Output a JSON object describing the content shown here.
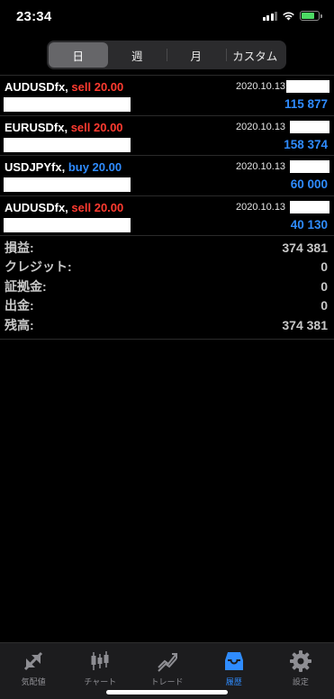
{
  "status_bar": {
    "time": "23:34"
  },
  "period_tabs": [
    {
      "label": "日",
      "active": true
    },
    {
      "label": "週",
      "active": false
    },
    {
      "label": "月",
      "active": false
    },
    {
      "label": "カスタム",
      "active": false
    }
  ],
  "deals": [
    {
      "symbol": "AUDUSDfx,",
      "side": "sell 20.00",
      "side_type": "sell",
      "date": "2020.10.13",
      "profit": "115 877"
    },
    {
      "symbol": "EURUSDfx,",
      "side": "sell 20.00",
      "side_type": "sell",
      "date": "2020.10.13",
      "profit": "158 374"
    },
    {
      "symbol": "USDJPYfx,",
      "side": "buy 20.00",
      "side_type": "buy",
      "date": "2020.10.13",
      "profit": "60 000"
    },
    {
      "symbol": "AUDUSDfx,",
      "side": "sell 20.00",
      "side_type": "sell",
      "date": "2020.10.13",
      "profit": "40 130"
    }
  ],
  "summary": [
    {
      "label": "損益:",
      "value": "374 381"
    },
    {
      "label": "クレジット:",
      "value": "0"
    },
    {
      "label": "証拠金:",
      "value": "0"
    },
    {
      "label": "出金:",
      "value": "0"
    },
    {
      "label": "残高:",
      "value": "374 381"
    }
  ],
  "tabbar": [
    {
      "label": "気配値",
      "icon": "quotes-icon",
      "active": false
    },
    {
      "label": "チャート",
      "icon": "chart-icon",
      "active": false
    },
    {
      "label": "トレード",
      "icon": "trade-icon",
      "active": false
    },
    {
      "label": "履歴",
      "icon": "history-icon",
      "active": true
    },
    {
      "label": "設定",
      "icon": "settings-icon",
      "active": false
    }
  ],
  "colors": {
    "sell": "#ff3b30",
    "buy": "#2f8cff",
    "active_tab": "#2f8cff",
    "battery": "#4cd964"
  }
}
